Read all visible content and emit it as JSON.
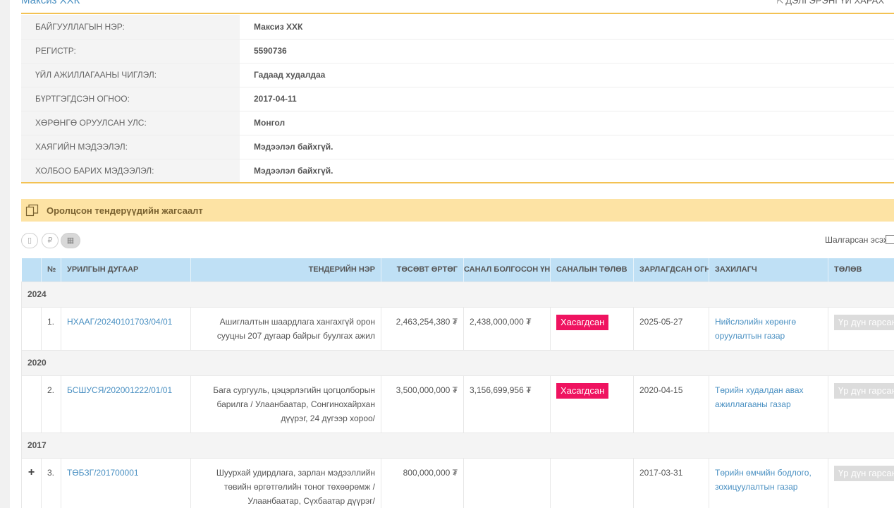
{
  "header": {
    "company_name": "Максиз ХХК",
    "detail_link": "ДЭЛГЭРЭНГҮЙ ХАРАХ"
  },
  "info": [
    {
      "label": "БАЙГУУЛЛАГЫН НЭР:",
      "value": "Максиз ХХК"
    },
    {
      "label": "РЕГИСТР:",
      "value": "5590736"
    },
    {
      "label": "ҮЙЛ АЖИЛЛАГААНЫ ЧИГЛЭЛ:",
      "value": "Гадаад худалдаа"
    },
    {
      "label": "БҮРТГЭГДСЭН ОГНОО:",
      "value": "2017-04-11"
    },
    {
      "label": "ХӨРӨНГӨ ОРУУЛСАН УЛС:",
      "value": "Монгол"
    },
    {
      "label": "ХАЯГИЙН МЭДЭЭЛЭЛ:",
      "value": "Мэдээлэл байхгүй."
    },
    {
      "label": "ХОЛБОО БАРИХ МЭДЭЭЛЭЛ:",
      "value": "Мэдээлэл байхгүй."
    }
  ],
  "section": {
    "title": "Оролцсон тендерүүдийн жагсаалт",
    "icon": "copy-icon"
  },
  "toolbar": {
    "view_icons": [
      "building-icon",
      "currency-icon",
      "calendar-icon"
    ],
    "filter_label": "Шалгарсан эсэх:"
  },
  "table": {
    "headers": [
      "№",
      "УРИЛГЫН ДУГААР",
      "ТЕНДЕРИЙН НЭР",
      "ТӨСӨВТ ӨРТӨГ",
      "САНАЛ БОЛГОСОН ҮНЭ",
      "САНАЛЫН ТӨЛӨВ",
      "ЗАРЛАГДСАН ОГНОО",
      "ЗАХИЛАГЧ",
      "ТӨЛӨВ"
    ],
    "groups": [
      {
        "year": "2024",
        "row": {
          "expand": "",
          "num": "1.",
          "code": "НХААГ/20240101703/04/01",
          "name": "Ашиглалтын шаардлага хангахгүй орон сууцны 207 дугаар байрыг буулгах ажил",
          "budget": "2,463,254,380 ₮",
          "offer": "2,438,000,000 ₮",
          "offer_status": "Хасагдсан",
          "date": "2025-05-27",
          "client": "Нийслэлийн хөрөнгө оруулалтын газар",
          "status": "Үр дүн гарсан"
        }
      },
      {
        "year": "2020",
        "row": {
          "expand": "",
          "num": "2.",
          "code": "БСШУСЯ/202001222/01/01",
          "name": "Бага сургууль, цэцэрлэгийн цогцолборын барилга / Улаанбаатар, Сонгинохайрхан дүүрэг, 24 дүгээр хороо/",
          "budget": "3,500,000,000 ₮",
          "offer": "3,156,699,956 ₮",
          "offer_status": "Хасагдсан",
          "date": "2020-04-15",
          "client": "Төрийн худалдан авах ажиллагааны газар",
          "status": "Үр дүн гарсан"
        }
      },
      {
        "year": "2017",
        "row": {
          "expand": "+",
          "num": "3.",
          "code": "ТӨБЗГ/201700001",
          "name": "Шуурхай удирдлага, зарлан мэдээллийн төвийн өргөтгөлийн тоног төхөөрөмж /Улаанбаатар, Сүхбаатар дүүрэг/",
          "budget": "800,000,000 ₮",
          "offer": "",
          "offer_status": "",
          "date": "2017-03-31",
          "client": "Төрийн өмчийн бодлого, зохицуулалтын газар",
          "status": "Үр дүн гарсан"
        }
      }
    ]
  },
  "colors": {
    "accent_gold": "#f3c253",
    "section_bg": "#fde3a4",
    "table_header_bg": "#bfe0f5",
    "link": "#4a90c2",
    "badge_red": "#ef1360",
    "badge_grey": "#dcdcdc"
  }
}
